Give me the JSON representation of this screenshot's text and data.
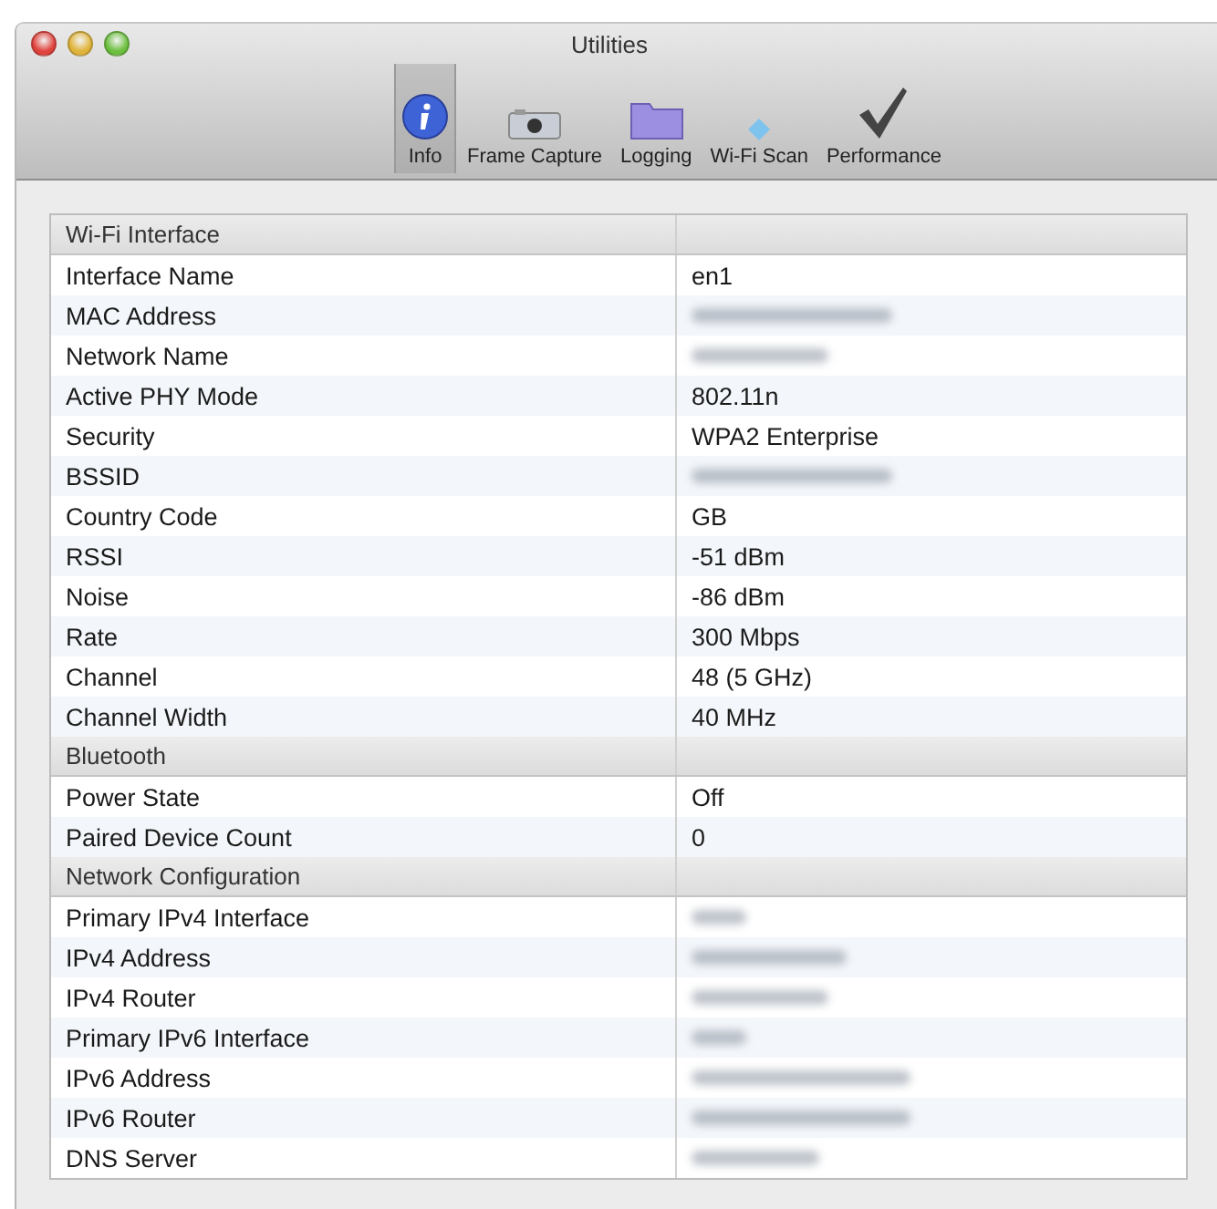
{
  "window": {
    "title": "Utilities"
  },
  "toolbar": [
    {
      "label": "Info",
      "selected": true
    },
    {
      "label": "Frame Capture",
      "selected": false
    },
    {
      "label": "Logging",
      "selected": false
    },
    {
      "label": "Wi-Fi Scan",
      "selected": false
    },
    {
      "label": "Performance",
      "selected": false
    }
  ],
  "table": {
    "rows": [
      {
        "kind": "section",
        "label": "Wi-Fi Interface"
      },
      {
        "kind": "row",
        "label": "Interface Name",
        "value": "en1"
      },
      {
        "kind": "row",
        "label": "MAC Address",
        "blurred": true
      },
      {
        "kind": "row",
        "label": "Network Name",
        "blurred": true
      },
      {
        "kind": "row",
        "label": "Active PHY Mode",
        "value": "802.11n"
      },
      {
        "kind": "row",
        "label": "Security",
        "value": "WPA2 Enterprise"
      },
      {
        "kind": "row",
        "label": "BSSID",
        "blurred": true
      },
      {
        "kind": "row",
        "label": "Country Code",
        "value": "GB"
      },
      {
        "kind": "row",
        "label": "RSSI",
        "value": "-51 dBm"
      },
      {
        "kind": "row",
        "label": "Noise",
        "value": "-86 dBm"
      },
      {
        "kind": "row",
        "label": "Rate",
        "value": "300 Mbps"
      },
      {
        "kind": "row",
        "label": "Channel",
        "value": "48 (5 GHz)"
      },
      {
        "kind": "row",
        "label": "Channel Width",
        "value": "40 MHz"
      },
      {
        "kind": "section",
        "label": "Bluetooth"
      },
      {
        "kind": "row",
        "label": "Power State",
        "value": "Off"
      },
      {
        "kind": "row",
        "label": "Paired Device Count",
        "value": "0"
      },
      {
        "kind": "section",
        "label": "Network Configuration"
      },
      {
        "kind": "row",
        "label": "Primary IPv4 Interface",
        "blurred": true
      },
      {
        "kind": "row",
        "label": "IPv4 Address",
        "blurred": true
      },
      {
        "kind": "row",
        "label": "IPv4 Router",
        "blurred": true
      },
      {
        "kind": "row",
        "label": "Primary IPv6 Interface",
        "blurred": true
      },
      {
        "kind": "row",
        "label": "IPv6 Address",
        "blurred": true
      },
      {
        "kind": "row",
        "label": "IPv6 Router",
        "blurred": true
      },
      {
        "kind": "row",
        "label": "DNS Server",
        "blurred": true
      }
    ]
  }
}
